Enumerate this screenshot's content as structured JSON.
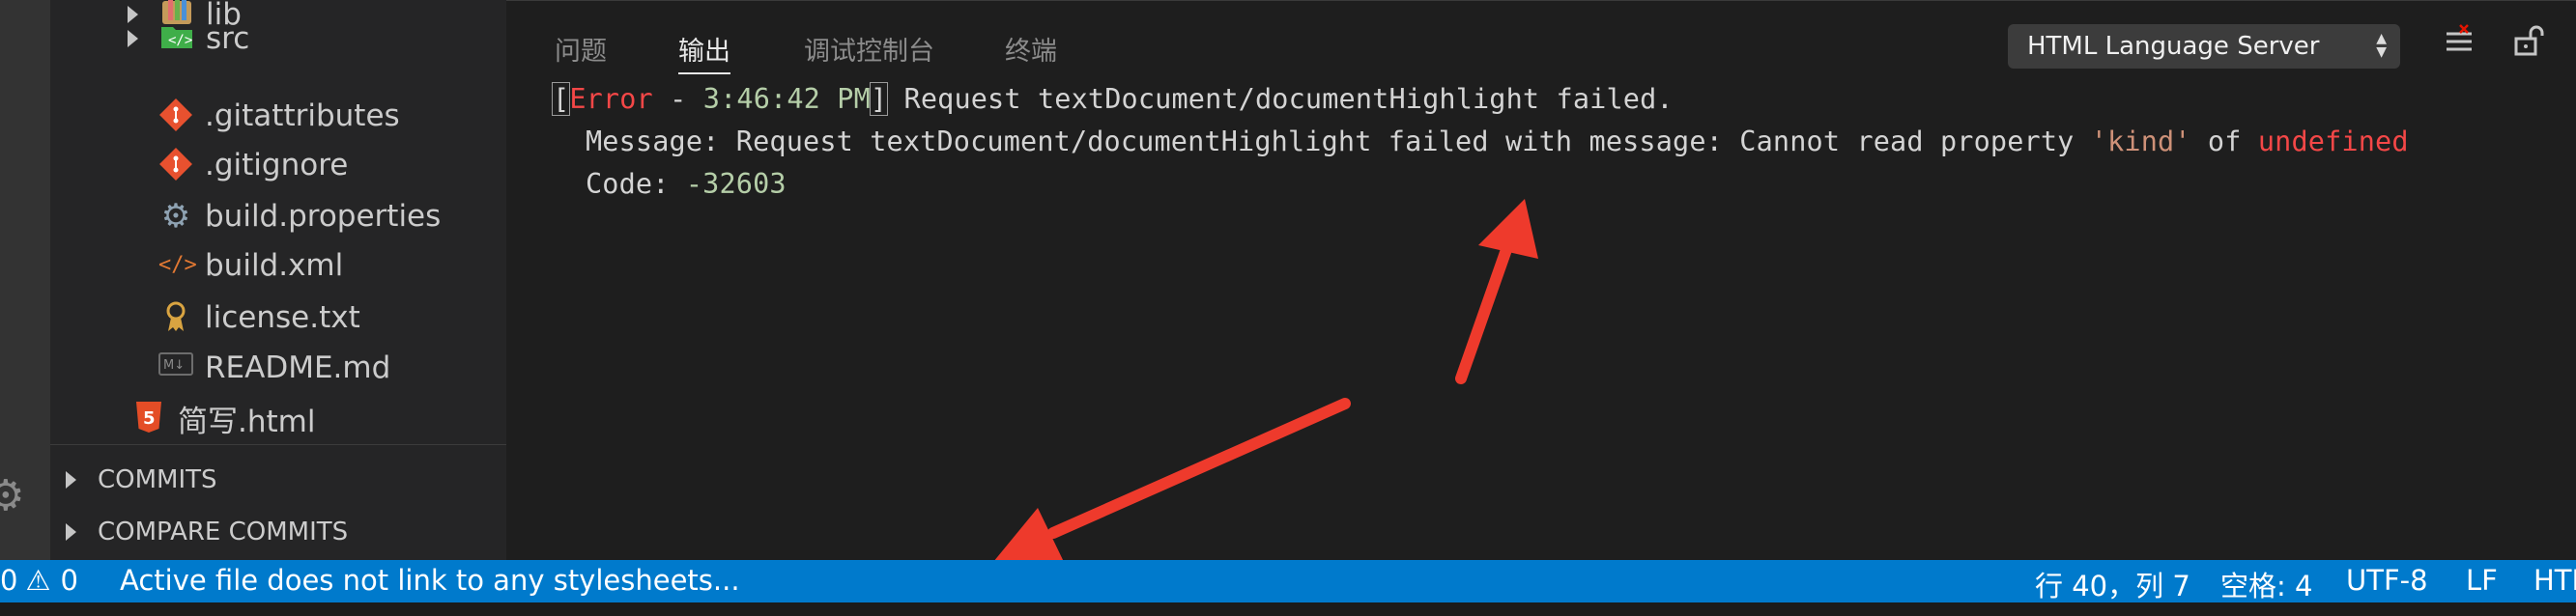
{
  "explorer": {
    "items": [
      {
        "label": "lib",
        "icon": "folder-lib-icon",
        "folder": true
      },
      {
        "label": "src",
        "icon": "folder-src-icon",
        "folder": true
      },
      {
        "label": ".gitattributes",
        "icon": "git-icon"
      },
      {
        "label": ".gitignore",
        "icon": "git-icon"
      },
      {
        "label": "build.properties",
        "icon": "gear-file-icon"
      },
      {
        "label": "build.xml",
        "icon": "xml-icon"
      },
      {
        "label": "license.txt",
        "icon": "license-icon"
      },
      {
        "label": "README.md",
        "icon": "markdown-icon"
      },
      {
        "label": "简写.html",
        "icon": "html5-icon"
      }
    ],
    "sections": [
      {
        "label": "COMMITS"
      },
      {
        "label": "COMPARE COMMITS"
      }
    ]
  },
  "panel": {
    "tabs": [
      {
        "label": "问题",
        "active": false
      },
      {
        "label": "输出",
        "active": true
      },
      {
        "label": "调试控制台",
        "active": false
      },
      {
        "label": "终端",
        "active": false
      }
    ],
    "output_channel": "HTML Language Server",
    "log": {
      "level": "Error",
      "time": "3:46:42 PM",
      "head": "Request textDocument/documentHighlight failed.",
      "message_prefix": "Message: Request textDocument/documentHighlight failed with message: Cannot read property ",
      "message_prop": "'kind'",
      "message_of": " of ",
      "message_undefined": "undefined",
      "code_label": "Code: ",
      "code_value": "-32603"
    }
  },
  "status_bar": {
    "errors": "0",
    "warnings": "0",
    "message": "Active file does not link to any stylesheets...",
    "position": "行 40，列 7",
    "spaces": "空格: 4",
    "encoding": "UTF-8",
    "eol": "LF",
    "language": "HTML"
  },
  "colors": {
    "status_bar": "#007acc",
    "arrow": "#ee3a2c",
    "error": "#f44747"
  }
}
